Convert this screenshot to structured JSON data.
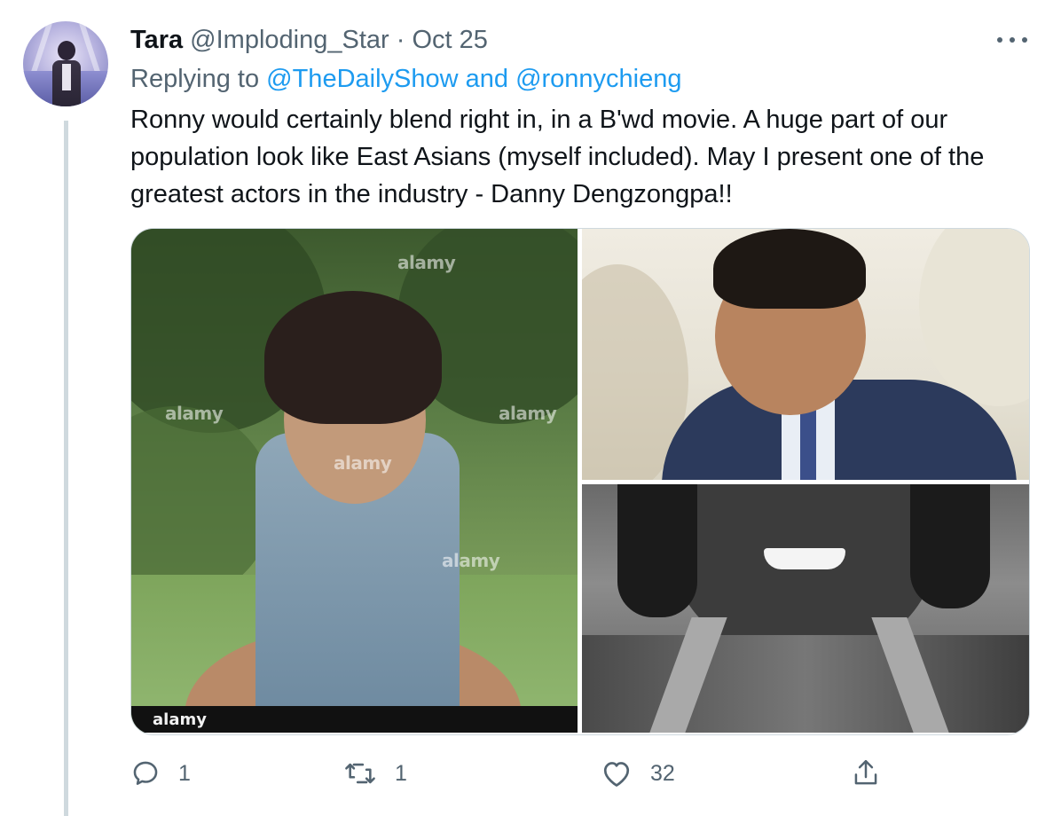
{
  "tweet": {
    "author_name": "Tara",
    "author_handle": "@Imploding_Star",
    "separator": "·",
    "date": "Oct 25",
    "replying_prefix": "Replying to",
    "replying_to": "@TheDailyShow and @ronnychieng",
    "text": "Ronny would certainly blend right in, in a B'wd movie. A huge part of our population look like East Asians (myself included). May I present one of the greatest actors in the industry - Danny Dengzongpa!!"
  },
  "media": {
    "watermark": "alamy",
    "photos": [
      {
        "name": "photo-man-sleeveless-denim",
        "icon": "photo"
      },
      {
        "name": "photo-man-suit-smiling",
        "icon": "photo"
      },
      {
        "name": "photo-man-black-and-white",
        "icon": "photo"
      }
    ]
  },
  "actions": {
    "reply_count": "1",
    "retweet_count": "1",
    "like_count": "32",
    "icons": [
      "reply-icon",
      "retweet-icon",
      "like-icon",
      "share-icon"
    ]
  },
  "colors": {
    "text_primary": "#0f1419",
    "text_secondary": "#536471",
    "link": "#1d9bf0",
    "border": "#cfd9de"
  }
}
